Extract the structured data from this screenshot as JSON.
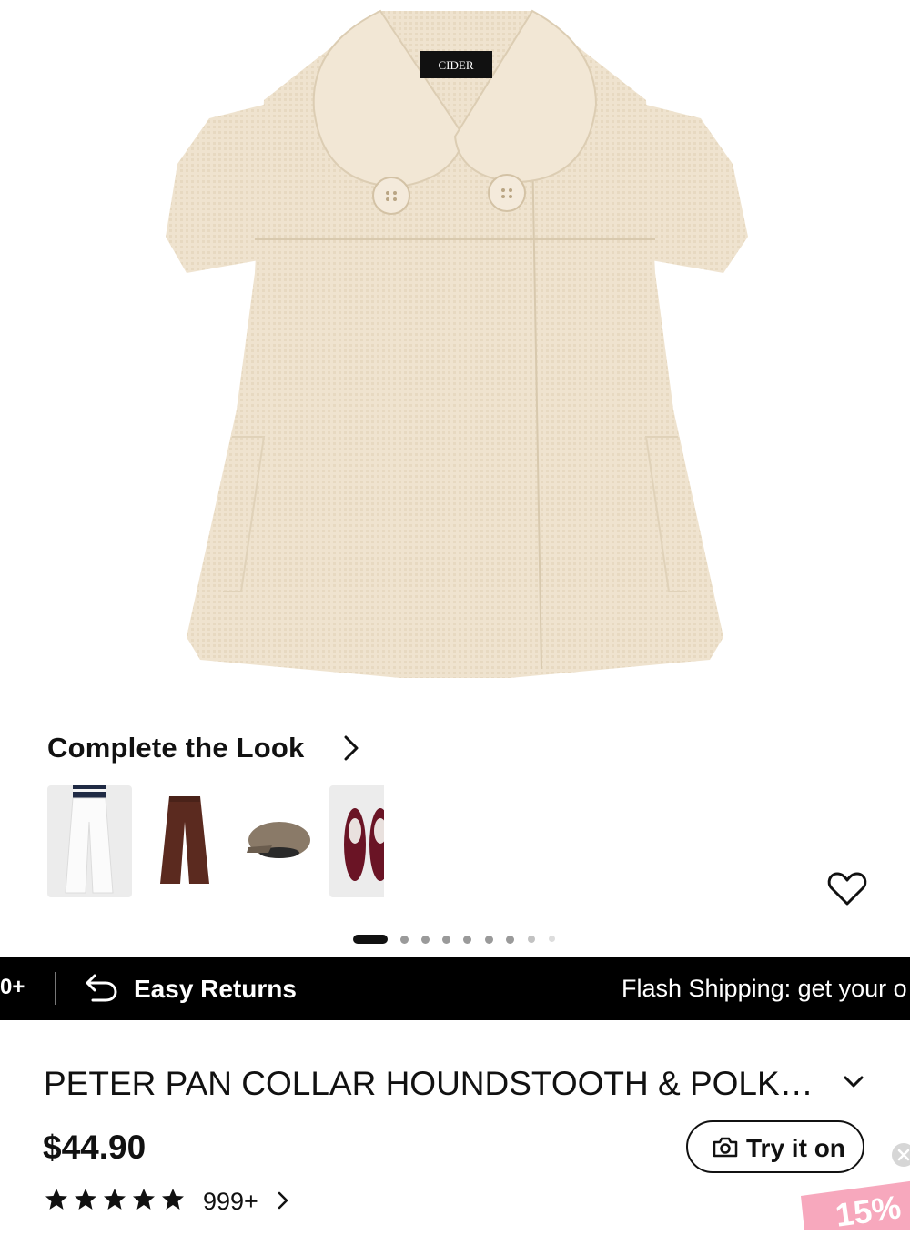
{
  "product_image": {
    "brand_label": "CIDER"
  },
  "complete_the_look": {
    "title": "Complete the Look",
    "items": [
      {
        "name": "white wide-leg jeans thumbnail"
      },
      {
        "name": "brown wide-leg trousers thumbnail"
      },
      {
        "name": "houndstooth newsboy cap thumbnail"
      },
      {
        "name": "burgundy ballet flats thumbnail"
      }
    ]
  },
  "carousel": {
    "total": 10,
    "active": 0
  },
  "banner": {
    "left_fragment": "0+",
    "returns_label": "Easy Returns",
    "shipping_text": "Flash Shipping: get your o"
  },
  "product": {
    "title": "PETER PAN COLLAR HOUNDSTOOTH & POLK…",
    "price": "$44.90",
    "try_on_label": "Try it on",
    "rating_stars": 5,
    "review_count": "999+"
  },
  "promo": {
    "badge_text": "15%"
  },
  "colors": {
    "banner_bg": "#000000",
    "jacket": "#efe3cf",
    "promo": "#f7a8bd"
  },
  "icons": [
    "chevron-right-icon",
    "heart-icon",
    "return-arrow-icon",
    "chevron-down-icon",
    "camera-icon",
    "star-icon",
    "close-icon"
  ]
}
